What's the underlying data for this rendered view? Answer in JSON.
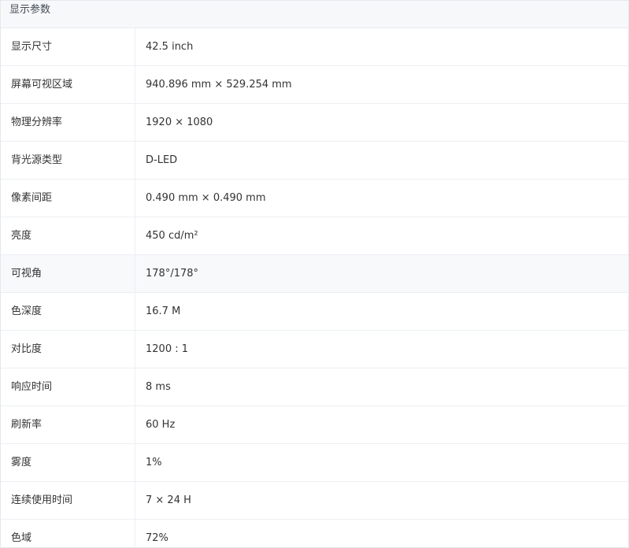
{
  "section": {
    "title": "显示参数"
  },
  "specs": [
    {
      "label": "显示尺寸",
      "value": "42.5 inch"
    },
    {
      "label": "屏幕可视区域",
      "value": "940.896 mm × 529.254 mm"
    },
    {
      "label": "物理分辨率",
      "value": "1920 × 1080"
    },
    {
      "label": "背光源类型",
      "value": "D-LED"
    },
    {
      "label": "像素间距",
      "value": "0.490 mm × 0.490 mm"
    },
    {
      "label": "亮度",
      "value": "450 cd/m²"
    },
    {
      "label": "可视角",
      "value": "178°/178°"
    },
    {
      "label": "色深度",
      "value": "16.7 M"
    },
    {
      "label": "对比度",
      "value": "1200 : 1"
    },
    {
      "label": "响应时间",
      "value": "8 ms"
    },
    {
      "label": "刷新率",
      "value": "60 Hz"
    },
    {
      "label": "雾度",
      "value": "1%"
    },
    {
      "label": "连续使用时间",
      "value": "7 × 24 H"
    },
    {
      "label": "色域",
      "value": "72%"
    }
  ]
}
